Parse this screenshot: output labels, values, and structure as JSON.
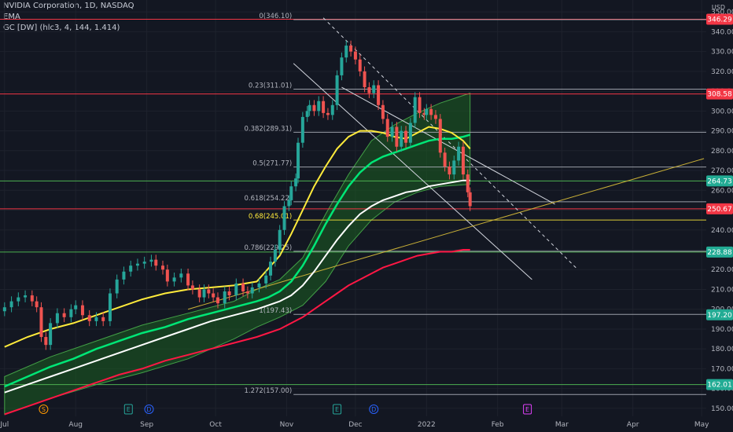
{
  "header": {
    "title": "NVIDIA Corporation, 1D, NASDAQ",
    "indicator_1": "EMA",
    "indicator_2": "GC [DW] (hlc3, 4, 144, 1.414)"
  },
  "currency": "USD",
  "colors": {
    "background": "#131722",
    "grid": "#1e222d",
    "candle_up": "#26a69a",
    "candle_up_bright": "#4caf50",
    "candle_down": "#ef5350",
    "ema_yellow": "#ffeb3b",
    "ema_green": "#00e676",
    "ema_white": "#ffffff",
    "ema_red": "#ff1744",
    "cloud": "#1b5e20",
    "trend_yellow": "#c9b037"
  },
  "chart_data": {
    "type": "candlestick",
    "ylim": [
      146,
      356
    ],
    "y_ticks": [
      150,
      160,
      170,
      180,
      190,
      200,
      210,
      220,
      230,
      240,
      250,
      260,
      270,
      280,
      290,
      300,
      310,
      320,
      330,
      340,
      350
    ],
    "x_ticks": [
      {
        "label": "Jul",
        "day": 0
      },
      {
        "label": "Aug",
        "day": 31
      },
      {
        "label": "Sep",
        "day": 62
      },
      {
        "label": "Oct",
        "day": 92
      },
      {
        "label": "Nov",
        "day": 123
      },
      {
        "label": "Dec",
        "day": 153
      },
      {
        "label": "2022",
        "day": 184
      },
      {
        "label": "Feb",
        "day": 215
      },
      {
        "label": "Mar",
        "day": 243
      },
      {
        "label": "Apr",
        "day": 274
      },
      {
        "label": "May",
        "day": 304
      }
    ],
    "fib_levels": [
      {
        "label": "0(346.10)",
        "value": 346.1,
        "color": "#b2b5be"
      },
      {
        "label": "0.23(311.01)",
        "value": 311.01,
        "color": "#b2b5be"
      },
      {
        "label": "0.382(289.31)",
        "value": 289.31,
        "color": "#b2b5be"
      },
      {
        "label": "0.5(271.77)",
        "value": 271.77,
        "color": "#b2b5be"
      },
      {
        "label": "0.618(254.22)",
        "value": 254.22,
        "color": "#b2b5be"
      },
      {
        "label": "0.68(245.01)",
        "value": 245.01,
        "color": "#ffeb3b"
      },
      {
        "label": "0.786(229.25)",
        "value": 229.25,
        "color": "#b2b5be"
      },
      {
        "label": "1(197.43)",
        "value": 197.43,
        "color": "#b2b5be"
      },
      {
        "label": "1.272(157.00)",
        "value": 157.0,
        "color": "#b2b5be"
      }
    ],
    "price_tags": [
      {
        "label": "346.29",
        "value": 346.29,
        "color": "#f23645"
      },
      {
        "label": "308.58",
        "value": 308.58,
        "color": "#f23645"
      },
      {
        "label": "264.73",
        "value": 264.73,
        "color": "#22ab94"
      },
      {
        "label": "250.67",
        "value": 250.67,
        "color": "#f23645"
      },
      {
        "label": "228.88",
        "value": 228.88,
        "color": "#22ab94"
      },
      {
        "label": "197.20",
        "value": 197.2,
        "color": "#22ab94"
      },
      {
        "label": "162.01",
        "value": 162.01,
        "color": "#22ab94"
      }
    ],
    "horizontal_lines": [
      {
        "value": 346.29,
        "color": "#f23645"
      },
      {
        "value": 308.58,
        "color": "#f23645"
      },
      {
        "value": 264.73,
        "color": "#4caf50"
      },
      {
        "value": 250.67,
        "color": "#f23645"
      },
      {
        "value": 228.88,
        "color": "#4caf50"
      },
      {
        "value": 162.01,
        "color": "#4caf50"
      }
    ],
    "event_markers": [
      {
        "label": "S",
        "day": 17,
        "color": "#ff9800"
      },
      {
        "label": "E",
        "day": 54,
        "color": "#26a69a"
      },
      {
        "label": "D",
        "day": 63,
        "color": "#2962ff"
      },
      {
        "label": "E",
        "day": 145,
        "color": "#26a69a"
      },
      {
        "label": "D",
        "day": 161,
        "color": "#2962ff"
      },
      {
        "label": "E",
        "day": 228,
        "color": "#e040fb"
      }
    ],
    "closes": [
      [
        0,
        201
      ],
      [
        3,
        204
      ],
      [
        6,
        206
      ],
      [
        9,
        207
      ],
      [
        12,
        204
      ],
      [
        14,
        201
      ],
      [
        16,
        186
      ],
      [
        18,
        182
      ],
      [
        20,
        193
      ],
      [
        23,
        198
      ],
      [
        26,
        196
      ],
      [
        29,
        200
      ],
      [
        31,
        202
      ],
      [
        34,
        197
      ],
      [
        37,
        194
      ],
      [
        40,
        196
      ],
      [
        43,
        194
      ],
      [
        46,
        208
      ],
      [
        49,
        215
      ],
      [
        52,
        219
      ],
      [
        55,
        222
      ],
      [
        58,
        223
      ],
      [
        61,
        224
      ],
      [
        64,
        225
      ],
      [
        66,
        222
      ],
      [
        69,
        220
      ],
      [
        71,
        214
      ],
      [
        74,
        216
      ],
      [
        77,
        218
      ],
      [
        80,
        212
      ],
      [
        82,
        210
      ],
      [
        85,
        206
      ],
      [
        87,
        210
      ],
      [
        89,
        208
      ],
      [
        91,
        206
      ],
      [
        93,
        203
      ],
      [
        96,
        209
      ],
      [
        98,
        207
      ],
      [
        101,
        213
      ],
      [
        104,
        209
      ],
      [
        106,
        208
      ],
      [
        108,
        211
      ],
      [
        111,
        213
      ],
      [
        114,
        217
      ],
      [
        116,
        224
      ],
      [
        118,
        230
      ],
      [
        120,
        240
      ],
      [
        122,
        252
      ],
      [
        124,
        255
      ],
      [
        125,
        262
      ],
      [
        127,
        266
      ],
      [
        128,
        284
      ],
      [
        130,
        297
      ],
      [
        132,
        300
      ],
      [
        133,
        303
      ],
      [
        135,
        300
      ],
      [
        137,
        305
      ],
      [
        139,
        299
      ],
      [
        141,
        298
      ],
      [
        143,
        303
      ],
      [
        145,
        318
      ],
      [
        147,
        327
      ],
      [
        149,
        333
      ],
      [
        151,
        330
      ],
      [
        153,
        326
      ],
      [
        155,
        320
      ],
      [
        157,
        312
      ],
      [
        159,
        309
      ],
      [
        161,
        313
      ],
      [
        163,
        303
      ],
      [
        165,
        296
      ],
      [
        167,
        287
      ],
      [
        169,
        292
      ],
      [
        171,
        282
      ],
      [
        173,
        290
      ],
      [
        175,
        284
      ],
      [
        177,
        294
      ],
      [
        179,
        307
      ],
      [
        181,
        299
      ],
      [
        183,
        298
      ],
      [
        184,
        301
      ],
      [
        186,
        298
      ],
      [
        188,
        296
      ],
      [
        190,
        279
      ],
      [
        192,
        272
      ],
      [
        194,
        268
      ],
      [
        196,
        275
      ],
      [
        198,
        282
      ],
      [
        200,
        268
      ],
      [
        202,
        259
      ],
      [
        203,
        252
      ]
    ],
    "candle_bodies_note": "candles derived from closes with small wicks",
    "ema_yellow": [
      [
        0,
        181
      ],
      [
        10,
        186
      ],
      [
        20,
        190
      ],
      [
        30,
        193
      ],
      [
        40,
        197
      ],
      [
        50,
        201
      ],
      [
        60,
        205
      ],
      [
        70,
        208
      ],
      [
        80,
        210
      ],
      [
        90,
        211
      ],
      [
        100,
        212
      ],
      [
        110,
        214
      ],
      [
        120,
        227
      ],
      [
        125,
        238
      ],
      [
        130,
        250
      ],
      [
        135,
        262
      ],
      [
        140,
        272
      ],
      [
        145,
        281
      ],
      [
        150,
        287
      ],
      [
        155,
        290
      ],
      [
        160,
        290
      ],
      [
        165,
        289
      ],
      [
        170,
        287
      ],
      [
        175,
        286
      ],
      [
        180,
        289
      ],
      [
        185,
        292
      ],
      [
        190,
        291
      ],
      [
        195,
        289
      ],
      [
        200,
        285
      ],
      [
        203,
        281
      ]
    ],
    "ema_green": [
      [
        0,
        161
      ],
      [
        10,
        166
      ],
      [
        20,
        171
      ],
      [
        30,
        175
      ],
      [
        40,
        180
      ],
      [
        50,
        184
      ],
      [
        60,
        188
      ],
      [
        70,
        191
      ],
      [
        80,
        195
      ],
      [
        90,
        198
      ],
      [
        100,
        201
      ],
      [
        110,
        204
      ],
      [
        115,
        206
      ],
      [
        120,
        209
      ],
      [
        125,
        214
      ],
      [
        130,
        222
      ],
      [
        135,
        232
      ],
      [
        140,
        243
      ],
      [
        145,
        253
      ],
      [
        150,
        262
      ],
      [
        155,
        269
      ],
      [
        160,
        274
      ],
      [
        165,
        277
      ],
      [
        170,
        279
      ],
      [
        175,
        281
      ],
      [
        180,
        283
      ],
      [
        185,
        285
      ],
      [
        190,
        286
      ],
      [
        195,
        286
      ],
      [
        200,
        287
      ],
      [
        203,
        288
      ]
    ],
    "ema_white": [
      [
        0,
        158
      ],
      [
        10,
        162
      ],
      [
        20,
        166
      ],
      [
        30,
        170
      ],
      [
        40,
        174
      ],
      [
        50,
        178
      ],
      [
        60,
        182
      ],
      [
        70,
        186
      ],
      [
        80,
        190
      ],
      [
        90,
        194
      ],
      [
        100,
        197
      ],
      [
        110,
        200
      ],
      [
        115,
        202
      ],
      [
        120,
        204
      ],
      [
        125,
        207
      ],
      [
        130,
        212
      ],
      [
        135,
        219
      ],
      [
        140,
        227
      ],
      [
        145,
        235
      ],
      [
        150,
        242
      ],
      [
        155,
        248
      ],
      [
        160,
        252
      ],
      [
        165,
        255
      ],
      [
        170,
        257
      ],
      [
        175,
        259
      ],
      [
        180,
        260
      ],
      [
        185,
        262
      ],
      [
        190,
        263
      ],
      [
        195,
        264
      ],
      [
        200,
        265
      ],
      [
        203,
        265
      ]
    ],
    "ema_red": [
      [
        0,
        147
      ],
      [
        10,
        151
      ],
      [
        20,
        155
      ],
      [
        30,
        159
      ],
      [
        40,
        163
      ],
      [
        50,
        167
      ],
      [
        60,
        170
      ],
      [
        70,
        174
      ],
      [
        80,
        177
      ],
      [
        90,
        180
      ],
      [
        100,
        183
      ],
      [
        110,
        186
      ],
      [
        120,
        190
      ],
      [
        125,
        193
      ],
      [
        130,
        196
      ],
      [
        135,
        200
      ],
      [
        140,
        204
      ],
      [
        145,
        208
      ],
      [
        150,
        212
      ],
      [
        155,
        215
      ],
      [
        160,
        218
      ],
      [
        165,
        221
      ],
      [
        170,
        223
      ],
      [
        175,
        225
      ],
      [
        180,
        227
      ],
      [
        185,
        228
      ],
      [
        190,
        229
      ],
      [
        195,
        229
      ],
      [
        200,
        230
      ],
      [
        203,
        230
      ]
    ],
    "cloud_upper": [
      [
        0,
        166
      ],
      [
        20,
        176
      ],
      [
        40,
        184
      ],
      [
        60,
        192
      ],
      [
        80,
        198
      ],
      [
        100,
        204
      ],
      [
        110,
        210
      ],
      [
        120,
        215
      ],
      [
        130,
        226
      ],
      [
        140,
        248
      ],
      [
        150,
        268
      ],
      [
        160,
        285
      ],
      [
        170,
        293
      ],
      [
        180,
        299
      ],
      [
        190,
        304
      ],
      [
        203,
        309
      ]
    ],
    "cloud_lower": [
      [
        0,
        147
      ],
      [
        20,
        155
      ],
      [
        40,
        162
      ],
      [
        60,
        168
      ],
      [
        80,
        175
      ],
      [
        100,
        185
      ],
      [
        110,
        191
      ],
      [
        120,
        196
      ],
      [
        130,
        202
      ],
      [
        140,
        214
      ],
      [
        150,
        232
      ],
      [
        160,
        245
      ],
      [
        170,
        254
      ],
      [
        180,
        259
      ],
      [
        190,
        262
      ],
      [
        203,
        263
      ]
    ],
    "trend_lines": [
      {
        "from": [
          139,
          347
        ],
        "to": [
          250,
          220
        ],
        "color": "#d1d4dc",
        "dashed": true
      },
      {
        "from": [
          126,
          324
        ],
        "to": [
          230,
          215
        ],
        "color": "#d1d4dc",
        "dashed": false
      },
      {
        "from": [
          147,
          312
        ],
        "to": [
          240,
          253
        ],
        "color": "#d1d4dc",
        "dashed": false
      },
      {
        "from": [
          80,
          200
        ],
        "to": [
          305,
          276
        ],
        "color": "#c9b037",
        "dashed": false
      }
    ]
  }
}
